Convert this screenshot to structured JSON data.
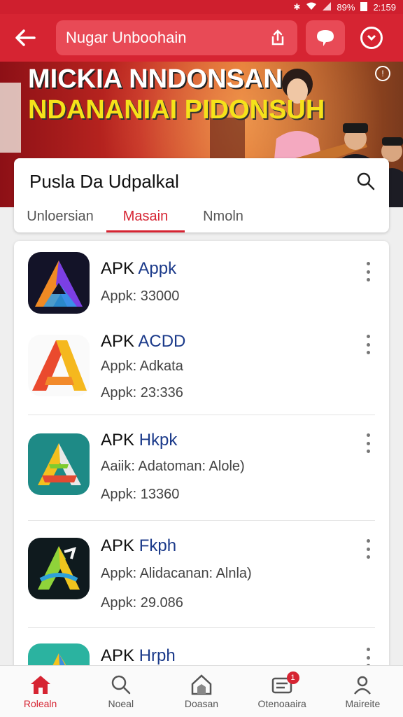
{
  "status_bar": {
    "battery": "89%",
    "time": "2:159"
  },
  "app_bar": {
    "title": "Nugar Unboohain",
    "icons": [
      "back-arrow-icon",
      "share-icon",
      "chat-icon",
      "chevron-down-icon"
    ]
  },
  "banner": {
    "line1": "MICKIA NNDONSAN",
    "line2": "NDANANIAI PIDONSUH",
    "info_icon": "info-icon"
  },
  "header": {
    "title": "Pusla Da Udpalkal",
    "tabs": [
      {
        "label": "Unloersian",
        "active": false
      },
      {
        "label": "Masain",
        "active": true
      },
      {
        "label": "Nmoln",
        "active": false
      }
    ]
  },
  "apps": [
    {
      "name_prefix": "APK",
      "name_accent": "Appk",
      "lines": [
        "Appk: 33000"
      ]
    },
    {
      "name_prefix": "APK",
      "name_accent": "ACDD",
      "lines": [
        "Appk:  Adkata",
        "Appk: 23:336"
      ]
    },
    {
      "name_prefix": "APK",
      "name_accent": "Hkpk",
      "lines": [
        "Aaiik:  Adatoman: Alole)",
        "Appk: 13360"
      ]
    },
    {
      "name_prefix": "APK",
      "name_accent": "Fkph",
      "lines": [
        "Appk:  Alidacanan: Alnla)",
        "Appk: 29.086"
      ]
    },
    {
      "name_prefix": "APK",
      "name_accent": "Hrph",
      "lines": []
    }
  ],
  "bottom_nav": [
    {
      "label": "Rolealn",
      "icon": "home-icon",
      "active": true
    },
    {
      "label": "Noeal",
      "icon": "search-icon",
      "active": false
    },
    {
      "label": "Doasan",
      "icon": "store-icon",
      "active": false
    },
    {
      "label": "Otenoaaira",
      "icon": "messages-icon",
      "active": false,
      "badge": "1"
    },
    {
      "label": "Maireite",
      "icon": "profile-icon",
      "active": false
    }
  ],
  "colors": {
    "primary": "#d62432",
    "accent_text": "#1b3a8a"
  }
}
